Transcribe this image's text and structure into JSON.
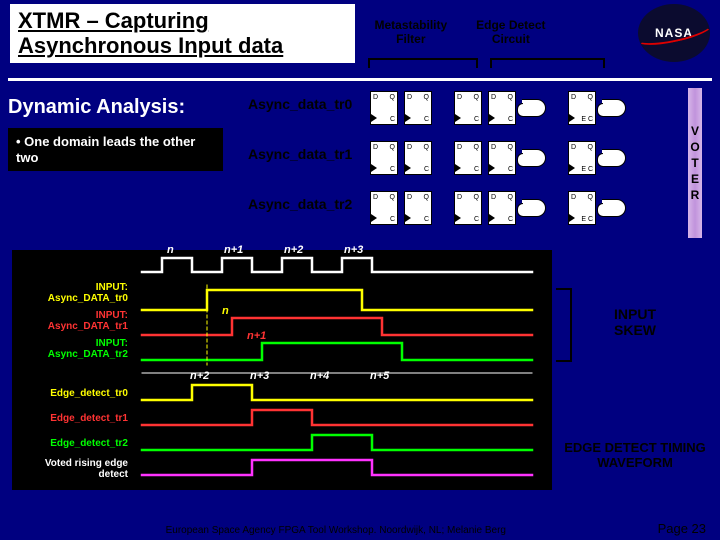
{
  "title_line1": "XTMR  – Capturing",
  "title_line2": "Asynchronous Input data",
  "header_labels": {
    "metastability": "Metastability\nFilter",
    "edge": "Edge Detect\nCircuit"
  },
  "logo_text": "NASA",
  "dynamic_heading": "Dynamic Analysis:",
  "bullet": "• One domain leads the other two",
  "lanes": [
    "Async_data_tr0",
    "Async_data_tr1",
    "Async_data_tr2"
  ],
  "voter_letters": [
    "V",
    "O",
    "T",
    "E",
    "R"
  ],
  "timing": {
    "input_labels": [
      "INPUT:\nAsync_DATA_tr0",
      "INPUT:\nAsync_DATA_tr1",
      "INPUT:\nAsync_DATA_tr2"
    ],
    "edge_labels": [
      "Edge_detect_tr0",
      "Edge_detect_tr1",
      "Edge_detect_tr2"
    ],
    "voted_label": "Voted rising edge detect",
    "clk_ticks": [
      "n",
      "n+1",
      "n+2",
      "n+3"
    ],
    "in1_tick": "n",
    "in2_tick": "n+1",
    "edge_ticks": [
      "n+2",
      "n+3",
      "n+4",
      "n+5"
    ]
  },
  "right_annotations": {
    "input_skew": "INPUT\nSKEW",
    "edge_waveform": "EDGE DETECT TIMING\nWAVEFORM"
  },
  "footer_text": "European Space Agency FPGA Tool Workshop. Noordwijk, NL; Melanie Berg",
  "page_label": "Page 23"
}
